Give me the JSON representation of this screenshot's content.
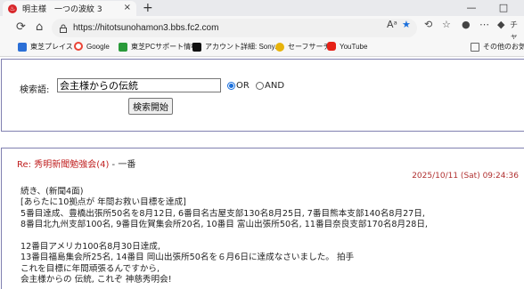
{
  "browser": {
    "tab_title": "明主様　一つの波紋 3",
    "tab_close": "×",
    "new_tab": "+",
    "url": "https://hitotsunohamon3.bbs.fc2.com",
    "minimize": "—",
    "maximize": "□",
    "bookmarks": [
      {
        "label": "東芝プレイス",
        "icon": "toshiba-icon",
        "color": "#2b6fd6"
      },
      {
        "label": "Google",
        "icon": "google-icon",
        "color": "#ea4335"
      },
      {
        "label": "東芝PCサポート情報",
        "icon": "toshiba-support-icon",
        "color": "#2a9a3a"
      },
      {
        "label": "アカウント詳細: Sony...",
        "icon": "sony-icon",
        "color": "#111111"
      },
      {
        "label": "セーフサーチ",
        "icon": "safesearch-icon",
        "color": "#e7b30b"
      },
      {
        "label": "YouTube",
        "icon": "youtube-icon",
        "color": "#e62117"
      }
    ],
    "right_label_1": "チャ",
    "other_favorites": "その他のお気に入り"
  },
  "search": {
    "label": "検索語:",
    "value": "会主様からの伝統",
    "or_label": "OR",
    "and_label": "AND",
    "or_selected": true,
    "button_label": "検索開始"
  },
  "post": {
    "title": "Re: 秀明新聞勉強会(4)",
    "separator": " - ",
    "author": "一番",
    "date": "2025/10/11 (Sat) 09:24:36",
    "lines": [
      "続き、(新聞4面)",
      "[あらたに10拠点が 年間お救い目標を達成]",
      "5番目達成、豊橋出張所50名を8月12日, 6番目名古屋支部130名8月25日, 7番目熊本支部140名8月27日,",
      "8番目北九州支部100名, 9番目佐賀集会所20名, 10番目 富山出張所50名, 11番目奈良支部170名8月28日,",
      "",
      "12番目アメリカ100名8月30日達成,",
      "13番目福島集会所25名, 14番目 岡山出張所50名を６月6日に達成なさいました。 拍手",
      "これを目標に年間頑張るんですから,",
      "会主様からの 伝統, これぞ 神慈秀明会!"
    ]
  }
}
